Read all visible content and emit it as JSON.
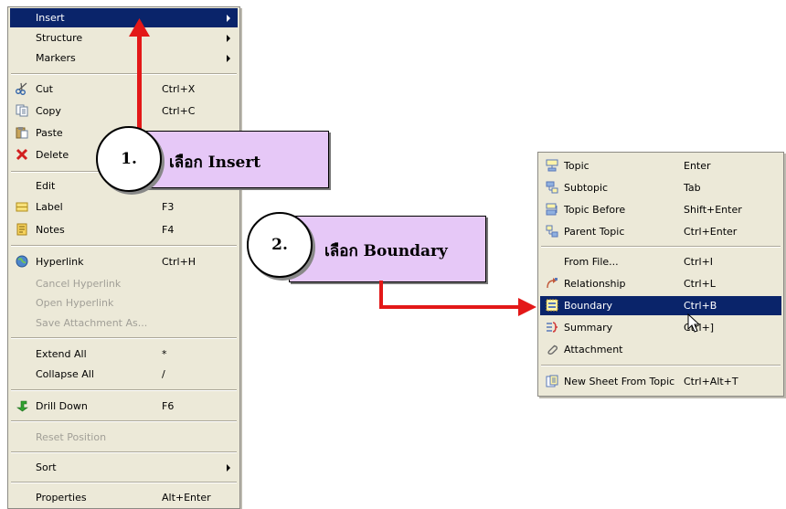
{
  "context_menu": {
    "items": [
      {
        "label": "Insert",
        "submenu": true,
        "highlighted": true
      },
      {
        "label": "Structure",
        "submenu": true
      },
      {
        "label": "Markers",
        "submenu": true
      },
      {
        "label": "Cut",
        "shortcut": "Ctrl+X",
        "icon": "scissors-icon"
      },
      {
        "label": "Copy",
        "shortcut": "Ctrl+C",
        "icon": "copy-icon"
      },
      {
        "label": "Paste",
        "icon": "paste-icon"
      },
      {
        "label": "Delete",
        "icon": "delete-icon"
      },
      {
        "label": "Edit"
      },
      {
        "label": "Label",
        "shortcut": "F3",
        "icon": "label-icon"
      },
      {
        "label": "Notes",
        "shortcut": "F4",
        "icon": "notes-icon"
      },
      {
        "label": "Hyperlink",
        "shortcut": "Ctrl+H",
        "icon": "globe-icon"
      },
      {
        "label": "Cancel Hyperlink",
        "disabled": true
      },
      {
        "label": "Open Hyperlink",
        "disabled": true
      },
      {
        "label": "Save Attachment As...",
        "disabled": true
      },
      {
        "label": "Extend All",
        "shortcut": "*"
      },
      {
        "label": "Collapse All",
        "shortcut": "/"
      },
      {
        "label": "Drill Down",
        "shortcut": "F6",
        "icon": "drill-down-arrow-icon"
      },
      {
        "label": "Reset Position",
        "disabled": true
      },
      {
        "label": "Sort",
        "submenu": true
      },
      {
        "label": "Properties",
        "shortcut": "Alt+Enter"
      }
    ]
  },
  "insert_submenu": {
    "items": [
      {
        "label": "Topic",
        "shortcut": "Enter",
        "icon": "topic-icon"
      },
      {
        "label": "Subtopic",
        "shortcut": "Tab",
        "icon": "subtopic-icon"
      },
      {
        "label": "Topic Before",
        "shortcut": "Shift+Enter",
        "icon": "topic-before-icon"
      },
      {
        "label": "Parent Topic",
        "shortcut": "Ctrl+Enter",
        "icon": "parent-topic-icon"
      },
      {
        "label": "From File...",
        "shortcut": "Ctrl+I"
      },
      {
        "label": "Relationship",
        "shortcut": "Ctrl+L",
        "icon": "relationship-icon"
      },
      {
        "label": "Boundary",
        "shortcut": "Ctrl+B",
        "icon": "boundary-icon",
        "highlighted": true
      },
      {
        "label": "Summary",
        "shortcut": "Ctrl+]",
        "icon": "summary-icon"
      },
      {
        "label": "Attachment",
        "icon": "paperclip-icon"
      },
      {
        "label": "New Sheet From Topic",
        "shortcut": "Ctrl+Alt+T",
        "icon": "new-sheet-icon"
      }
    ]
  },
  "annotations": {
    "step1": {
      "number": "1.",
      "text": "เลือก Insert"
    },
    "step2": {
      "number": "2.",
      "text": "เลือก Boundary"
    }
  },
  "colors": {
    "menu_bg": "#ece9d8",
    "highlight": "#0a246a",
    "callout_fill": "#e6c8f7",
    "arrow": "#e31818",
    "disabled_text": "#a19f97"
  }
}
